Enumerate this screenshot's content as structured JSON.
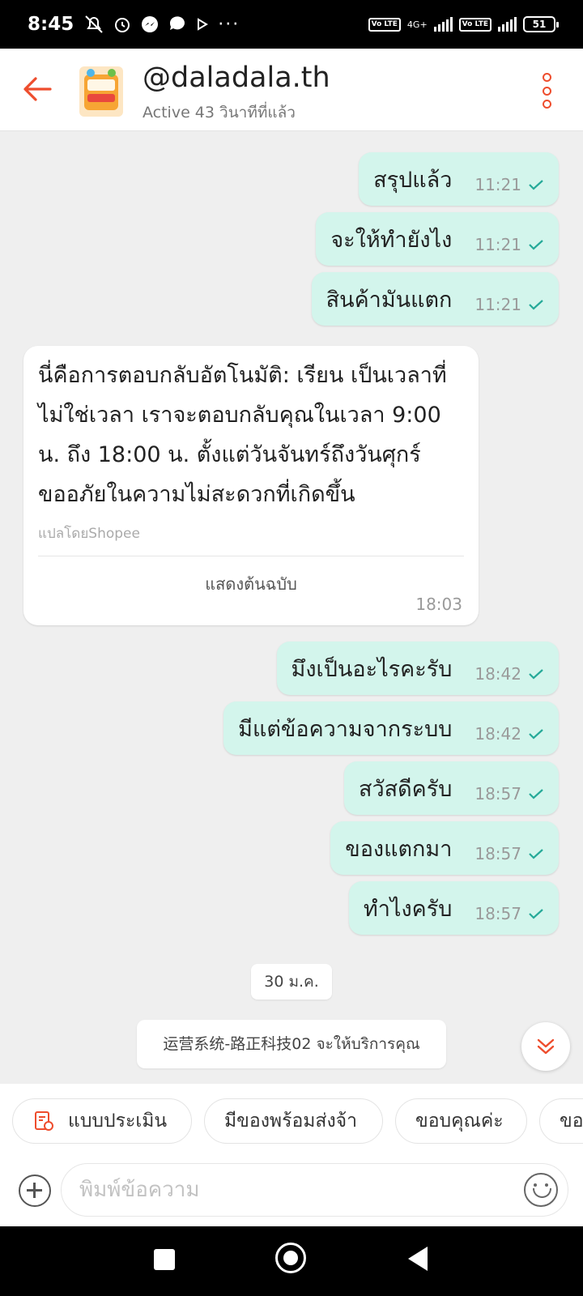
{
  "statusbar": {
    "time": "8:45",
    "network": "4G+",
    "volte": "Vo LTE",
    "battery": "51"
  },
  "header": {
    "title": "@daladala.th",
    "subtitle": "Active 43 วินาทีที่แล้ว",
    "avatar_text": "GROCERY STORE"
  },
  "messages": [
    {
      "text": "สรุปแล้ว",
      "time": "11:21"
    },
    {
      "text": "จะให้ทำยังไง",
      "time": "11:21"
    },
    {
      "text": "สินค้ามันแตก",
      "time": "11:21"
    },
    {
      "text": "มึงเป็นอะไรคะรับ",
      "time": "18:42"
    },
    {
      "text": "มีแต่ข้อความจากระบบ",
      "time": "18:42"
    },
    {
      "text": "สวัสดีครับ",
      "time": "18:57"
    },
    {
      "text": "ของแตกมา",
      "time": "18:57"
    },
    {
      "text": "ทำไงครับ",
      "time": "18:57"
    }
  ],
  "auto_reply": {
    "lines": [
      "นี่คือการตอบกลับอัตโนมัติ: เรียน เป็นเวลาที่",
      "ไม่ใช่เวลา เราจะตอบกลับคุณในเวลา 9:00",
      "น. ถึง 18:00 น. ตั้งแต่วันจันทร์ถึงวันศุกร์",
      "ขออภัยในความไม่สะดวกที่เกิดขึ้น"
    ],
    "translated_by": "แปลโดยShopee",
    "show_original": "แสดงต้นฉบับ",
    "time": "18:03"
  },
  "date_chip": "30 ม.ค.",
  "system_notice": "运营系统-路正科技02 จะให้บริการคุณ",
  "quick_replies": [
    "แบบประเมิน",
    "มีของพร้อมส่งจ้า",
    "ขอบคุณค่ะ",
    "ขอ"
  ],
  "input": {
    "placeholder": "พิมพ์ข้อความ",
    "value": ""
  },
  "colors": {
    "accent": "#ee4d2d",
    "outgoing_bubble": "#d3f5ec",
    "tick": "#26aa99"
  }
}
